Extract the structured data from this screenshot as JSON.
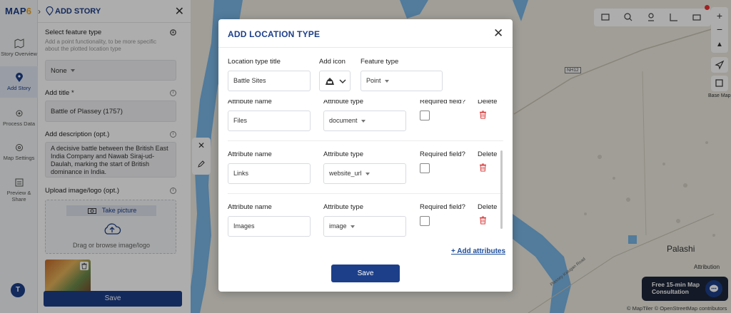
{
  "app": {
    "logo_left": "MAP",
    "logo_right": "6"
  },
  "rail": {
    "items": [
      {
        "label": "Story Overview"
      },
      {
        "label": "Add Story"
      },
      {
        "label": "Process Data"
      },
      {
        "label": "Map Settings"
      },
      {
        "label": "Preview & Share"
      }
    ],
    "avatar": "T"
  },
  "panel": {
    "title": "ADD STORY",
    "feature_type_label": "Select feature type",
    "feature_type_hint": "Add a point functionality, to be more specific about the plotted location type",
    "feature_type_value": "None",
    "title_label": "Add title *",
    "title_value": "Battle of Plassey (1757)",
    "desc_label": "Add description (opt.)",
    "desc_value": "A decisive battle between the British East India Company and Nawab Siraj-ud-Daulah, marking the start of British dominance in India.",
    "upload_label": "Upload image/logo (opt.)",
    "take_picture": "Take picture",
    "drag_browse": "Drag or browse image/logo",
    "save": "Save"
  },
  "map": {
    "place": "Palashi",
    "nh_badge": "NH12",
    "road": "Plassey Kalugan Road",
    "attribution": "Attribution",
    "footer": "© MapTiler © OpenStreetMap contributors",
    "base_map": "Base Map",
    "consult_line1": "Free 15-min Map",
    "consult_line2": "Consultation",
    "colors": {
      "water": "#79b6e6",
      "land": "#ece9df",
      "accent": "#1d3f8a"
    }
  },
  "modal": {
    "title": "ADD LOCATION TYPE",
    "loc_title_label": "Location type title",
    "loc_title_value": "Battle Sites",
    "add_icon_label": "Add icon",
    "feature_type_label": "Feature type",
    "feature_type_value": "Point",
    "attributes": [
      {
        "name_label": "Attribute name",
        "name_value": "Files",
        "type_label": "Attribute type",
        "type_value": "document",
        "required_label": "Required field?",
        "delete_label": "Delete"
      },
      {
        "name_label": "Attribute name",
        "name_value": "Links",
        "type_label": "Attribute type",
        "type_value": "website_url",
        "required_label": "Required field?",
        "delete_label": "Delete"
      },
      {
        "name_label": "Attribute name",
        "name_value": "Images",
        "type_label": "Attribute type",
        "type_value": "image",
        "required_label": "Required field?",
        "delete_label": "Delete"
      }
    ],
    "add_attributes": "+ Add attributes",
    "save": "Save"
  }
}
